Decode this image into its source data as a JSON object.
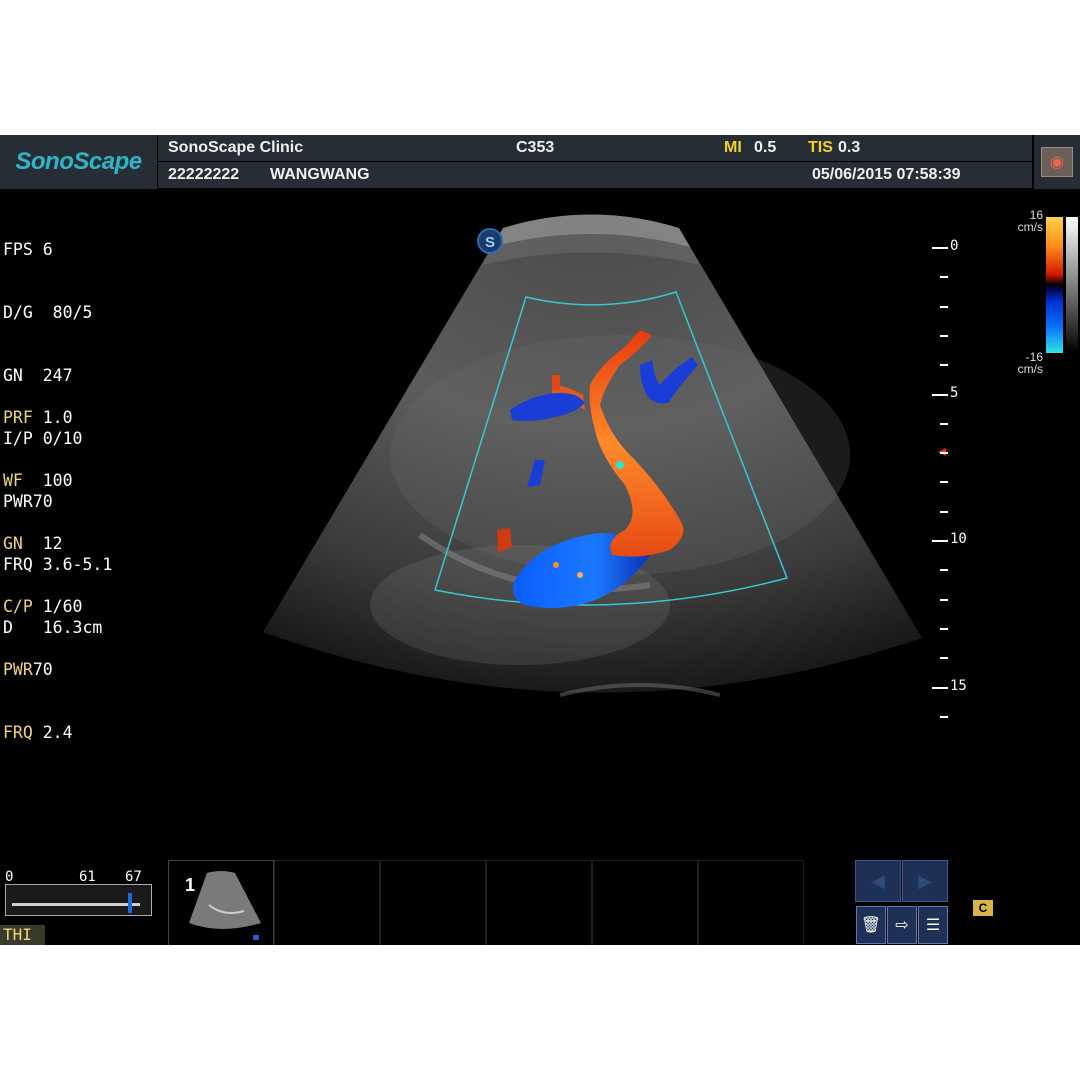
{
  "header": {
    "logo": "SonoScape",
    "clinic": "SonoScape Clinic",
    "probe": "C353",
    "mi_label": "MI",
    "mi_value": "0.5",
    "tis_label": "TIS",
    "tis_value": "0.3",
    "patient_id": "22222222",
    "patient_name": "WANGWANG",
    "datetime": "05/06/2015 07:58:39"
  },
  "bmode_params": [
    {
      "label": "FPS",
      "value": " 6"
    },
    {
      "label": "D/G",
      "value": "  80/5"
    },
    {
      "label": "GN",
      "value": "  247"
    },
    {
      "label": "I/P",
      "value": " 0/10"
    },
    {
      "label": "PWR",
      "value": "70"
    },
    {
      "label": "FRQ",
      "value": " 3.6-5.1"
    },
    {
      "label": "D",
      "value": "   16.3cm"
    }
  ],
  "color_params": [
    {
      "label": "PRF",
      "value": " 1.0"
    },
    {
      "label": "WF",
      "value": "  100"
    },
    {
      "label": "GN",
      "value": "  12"
    },
    {
      "label": "C/P",
      "value": " 1/60"
    },
    {
      "label": "PWR",
      "value": "70"
    },
    {
      "label": "FRQ",
      "value": " 2.4"
    }
  ],
  "colorbar": {
    "top_value": "16",
    "top_unit": "cm/s",
    "bottom_value": "-16",
    "bottom_unit": "cm/s"
  },
  "depth_scale": {
    "labels": [
      "0",
      "5",
      "10",
      "15"
    ]
  },
  "slider": {
    "min_label": "0",
    "mid_label": "61",
    "max_label": "67",
    "position_fraction": 0.91
  },
  "thi_label": "THI",
  "thumbnails": {
    "first_number": "1"
  },
  "cine_label": "C",
  "colors": {
    "header_bg": "#262d34",
    "logo": "#2fb6c6",
    "warn_yellow": "#f2d21a",
    "roi_box": "#35c8d6"
  }
}
